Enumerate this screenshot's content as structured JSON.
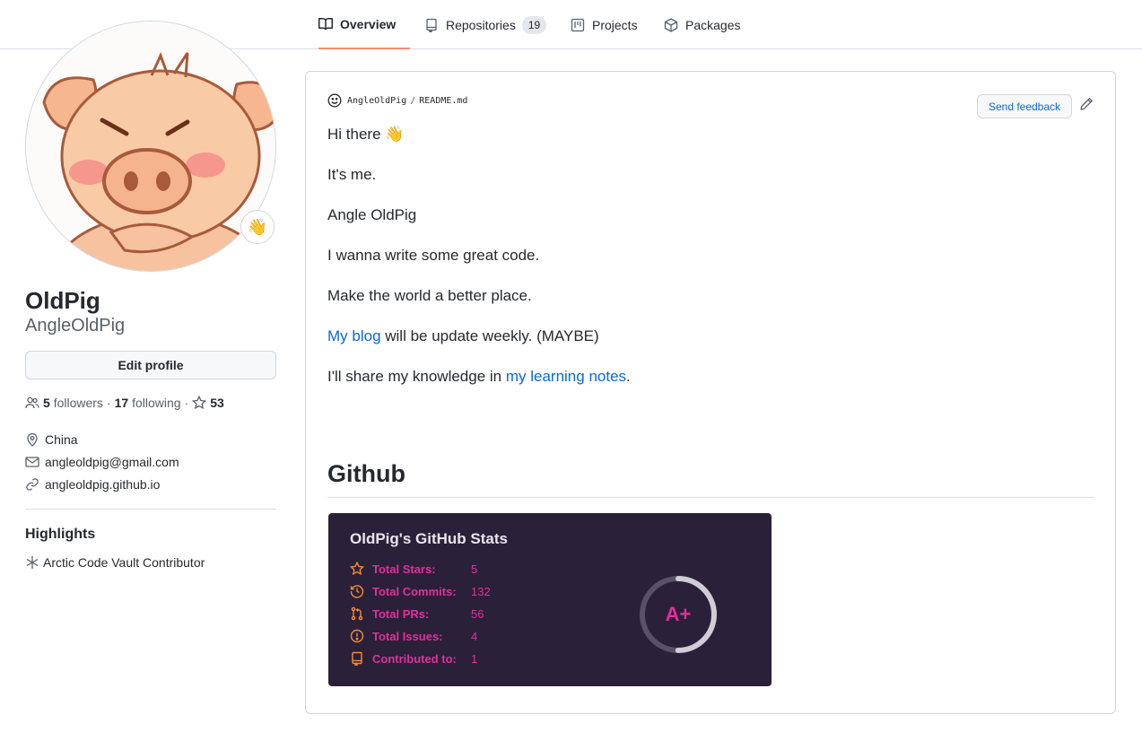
{
  "tabs": [
    {
      "label": "Overview",
      "icon": "book-icon",
      "active": true
    },
    {
      "label": "Repositories",
      "icon": "repo-icon",
      "count": "19"
    },
    {
      "label": "Projects",
      "icon": "project-icon"
    },
    {
      "label": "Packages",
      "icon": "package-icon"
    }
  ],
  "profile": {
    "emoji": "👋",
    "name": "OldPig",
    "login": "AngleOldPig",
    "edit_label": "Edit profile",
    "followers_count": "5",
    "followers_label": "followers",
    "following_count": "17",
    "following_label": "following",
    "stars_count": "53",
    "location": "China",
    "email": "angleoldpig@gmail.com",
    "website": "angleoldpig.github.io",
    "highlights_title": "Highlights",
    "highlight_item": "Arctic Code Vault Contributor"
  },
  "readme": {
    "owner": "AngleOldPig",
    "separator": "/",
    "file": "README.md",
    "feedback_label": "Send feedback",
    "greeting": "Hi there",
    "greeting_emoji": "👋",
    "line1": "It's me.",
    "line2": "Angle OldPig",
    "line3": "I wanna write some great code.",
    "line4": "Make the world a better place.",
    "blog_link": "My blog",
    "blog_rest": " will be update weekly. (MAYBE)",
    "notes_prefix": "I'll share my knowledge in ",
    "notes_link": "my learning notes",
    "notes_suffix": ".",
    "section_title": "Github"
  },
  "stats_card": {
    "title": "OldPig's GitHub Stats",
    "rows": [
      {
        "label": "Total Stars:",
        "value": "5",
        "icon": "star-icon"
      },
      {
        "label": "Total Commits:",
        "value": "132",
        "icon": "history-icon"
      },
      {
        "label": "Total PRs:",
        "value": "56",
        "icon": "pull-request-icon"
      },
      {
        "label": "Total Issues:",
        "value": "4",
        "icon": "issue-icon"
      },
      {
        "label": "Contributed to:",
        "value": "1",
        "icon": "repo-icon"
      }
    ],
    "rank": "A+",
    "rank_progress": 0.5,
    "bg_color": "#2b2039",
    "accent_color": "#e0309c",
    "icon_color": "#f28d35"
  },
  "colors": {
    "link": "#0969da",
    "active_tab_underline": "#fd8c73"
  }
}
